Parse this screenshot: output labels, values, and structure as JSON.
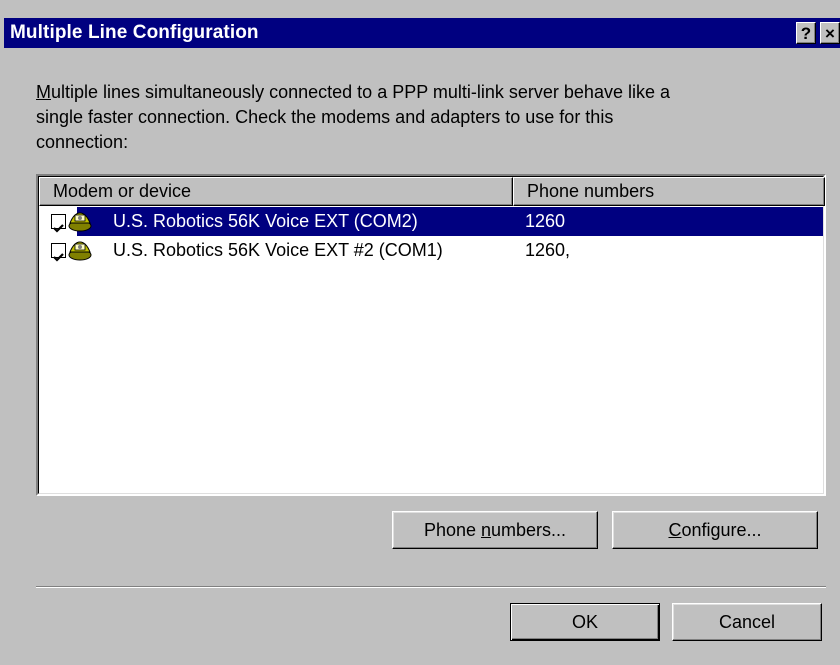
{
  "window": {
    "title": "Multiple Line Configuration",
    "help_glyph": "?",
    "close_glyph": "×"
  },
  "description": {
    "line1_first": "M",
    "line1_rest": "ultiple lines simultaneously connected to a PPP multi-link server behave like a",
    "line2": "single faster connection.  Check the modems and adapters to use for this",
    "line3": "connection:"
  },
  "list": {
    "columns": {
      "modem": "Modem or device",
      "phone": "Phone numbers"
    },
    "rows": [
      {
        "checked": true,
        "device": "U.S. Robotics 56K Voice EXT (COM2)",
        "phone": "1260",
        "selected": true,
        "icon": "modem-icon"
      },
      {
        "checked": true,
        "device": "U.S. Robotics 56K Voice EXT #2 (COM1)",
        "phone": "1260,",
        "selected": false,
        "icon": "modem-icon"
      }
    ]
  },
  "buttons": {
    "phone_numbers_pre": "Phone ",
    "phone_numbers_accel": "n",
    "phone_numbers_post": "umbers...",
    "configure_accel": "C",
    "configure_post": "onfigure...",
    "ok": "OK",
    "cancel": "Cancel"
  },
  "colors": {
    "face": "#c0c0c0",
    "titlebar": "#000080",
    "selection": "#000080"
  }
}
